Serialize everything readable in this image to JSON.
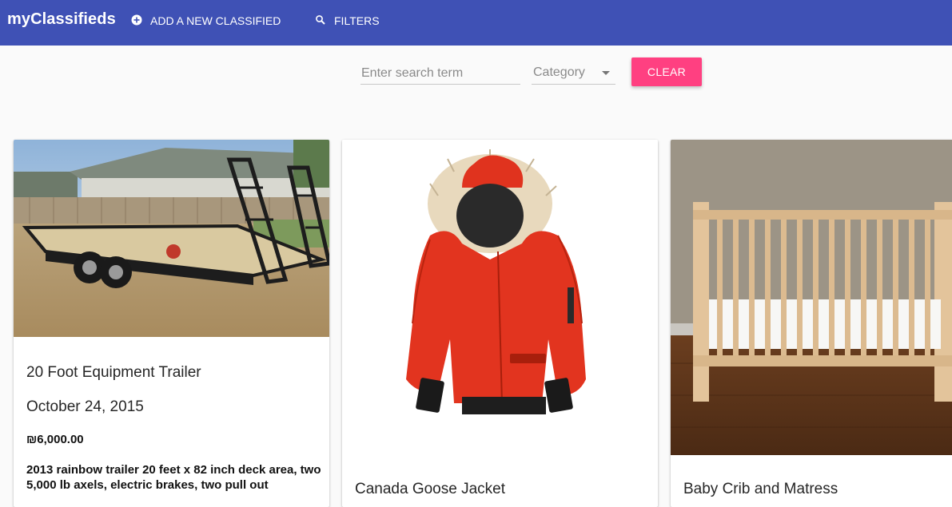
{
  "app": {
    "title": "myClassifieds"
  },
  "toolbar": {
    "add_label": "ADD A NEW CLASSIFIED",
    "add_icon": "add-circle-icon",
    "filters_label": "FILTERS",
    "filters_icon": "search-icon",
    "color": "#3f51b5"
  },
  "search": {
    "placeholder": "Enter search term",
    "value": ""
  },
  "category": {
    "label": "Category",
    "icon": "arrow-drop-down-icon"
  },
  "clear": {
    "label": "CLEAR",
    "color": "#ff4081"
  },
  "classifieds": [
    {
      "title": "20 Foot Equipment Trailer",
      "date": "October 24, 2015",
      "price": "₪6,000.00",
      "description": "2013 rainbow trailer 20 feet x 82 inch deck area, two 5,000 lb axels, electric brakes, two pull out",
      "image": "equipment-trailer-photo"
    },
    {
      "title": "Canada Goose Jacket",
      "image": "red-parka-jacket-photo"
    },
    {
      "title": "Baby Crib and Matress",
      "image": "wooden-baby-crib-photo"
    }
  ]
}
